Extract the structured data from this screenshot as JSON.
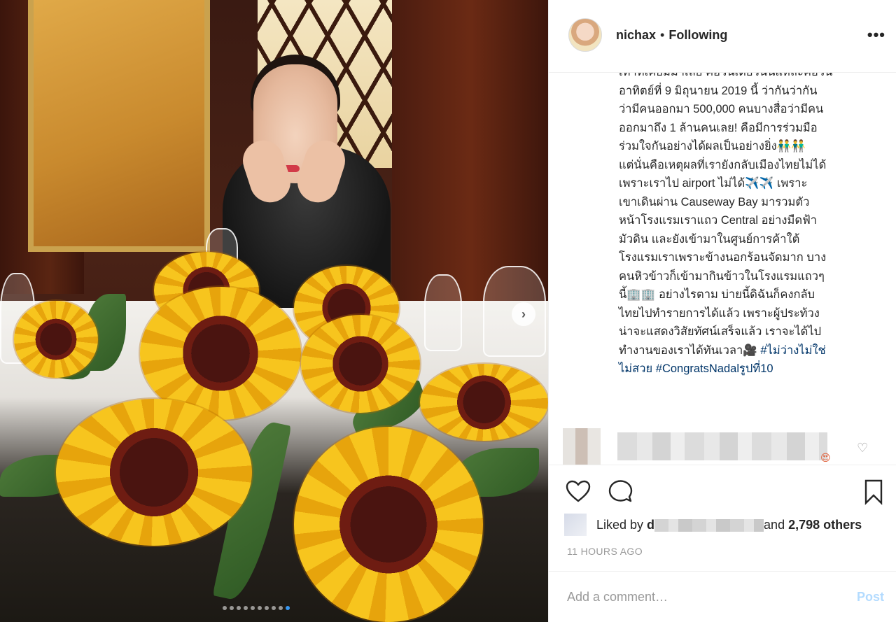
{
  "header": {
    "username": "nichax",
    "separator": "•",
    "following_label": "Following",
    "more_label": "•••"
  },
  "caption": {
    "top_partial_line": "เท่าที่เคยมีมาเลย คือวันเดียวนั่นแหละคือวัน",
    "text": "อาทิตย์ที่ 9 มิถุนายน 2019 นี้ ว่ากันว่ากัน\nว่ามีคนออกมา 500,000 คนบางสื่อว่ามีคน\nออกมาถึง 1 ล้านคนเลย! คือมีการร่วมมือ\nร่วมใจกันอย่างได้ผลเป็นอย่างยิ่ง👬👬\nแต่นั่นคือเหตุผลที่เรายังกลับเมืองไทยไม่ได้\nเพราะเราไป airport ไม่ได้✈️✈️ เพราะ\nเขาเดินผ่าน Causeway Bay มารวมตัว\nหน้าโรงแรมเราแถว Central อย่างมืดฟ้า\nมัวดิน และยังเข้ามาในศูนย์การค้าใต้\nโรงแรมเราเพราะข้างนอกร้อนจัดมาก บาง\nคนหิวข้าวก็เข้ามากินข้าวในโรงแรมแถวๆ\nนี้🏢🏢 อย่างไรตาม บ่ายนี้ดิฉันก็คงกลับ\nไทยไปทำรายการได้แล้ว เพราะผู้ประท้วง\nน่าจะแสดงวิสัยทัศน์เสร็จแล้ว เราจะได้ไป\nทำงานของเราได้ทันเวลา🎥",
    "hashtags": " #ไม่ว่างไม่ใช่\nไม่สวย #CongratsNadalรูปที่10",
    "time": "11h"
  },
  "comment": {
    "emoji": "😍",
    "like_icon": "♡"
  },
  "actions": {
    "like": "heart-icon",
    "comment": "comment-icon",
    "save": "bookmark-icon"
  },
  "likes": {
    "prefix": "Liked by ",
    "first_letter": "d",
    "middle": "and ",
    "count": "2,798 others"
  },
  "timestamp": "11 HOURS AGO",
  "add_comment": {
    "placeholder": "Add a comment…",
    "post_label": "Post"
  },
  "carousel": {
    "next_label": "›",
    "dot_count": 10,
    "active_index": 9
  },
  "colors": {
    "link": "#003569",
    "muted": "#999999",
    "post_disabled": "#b3dbff",
    "active_dot": "#3897f0"
  }
}
